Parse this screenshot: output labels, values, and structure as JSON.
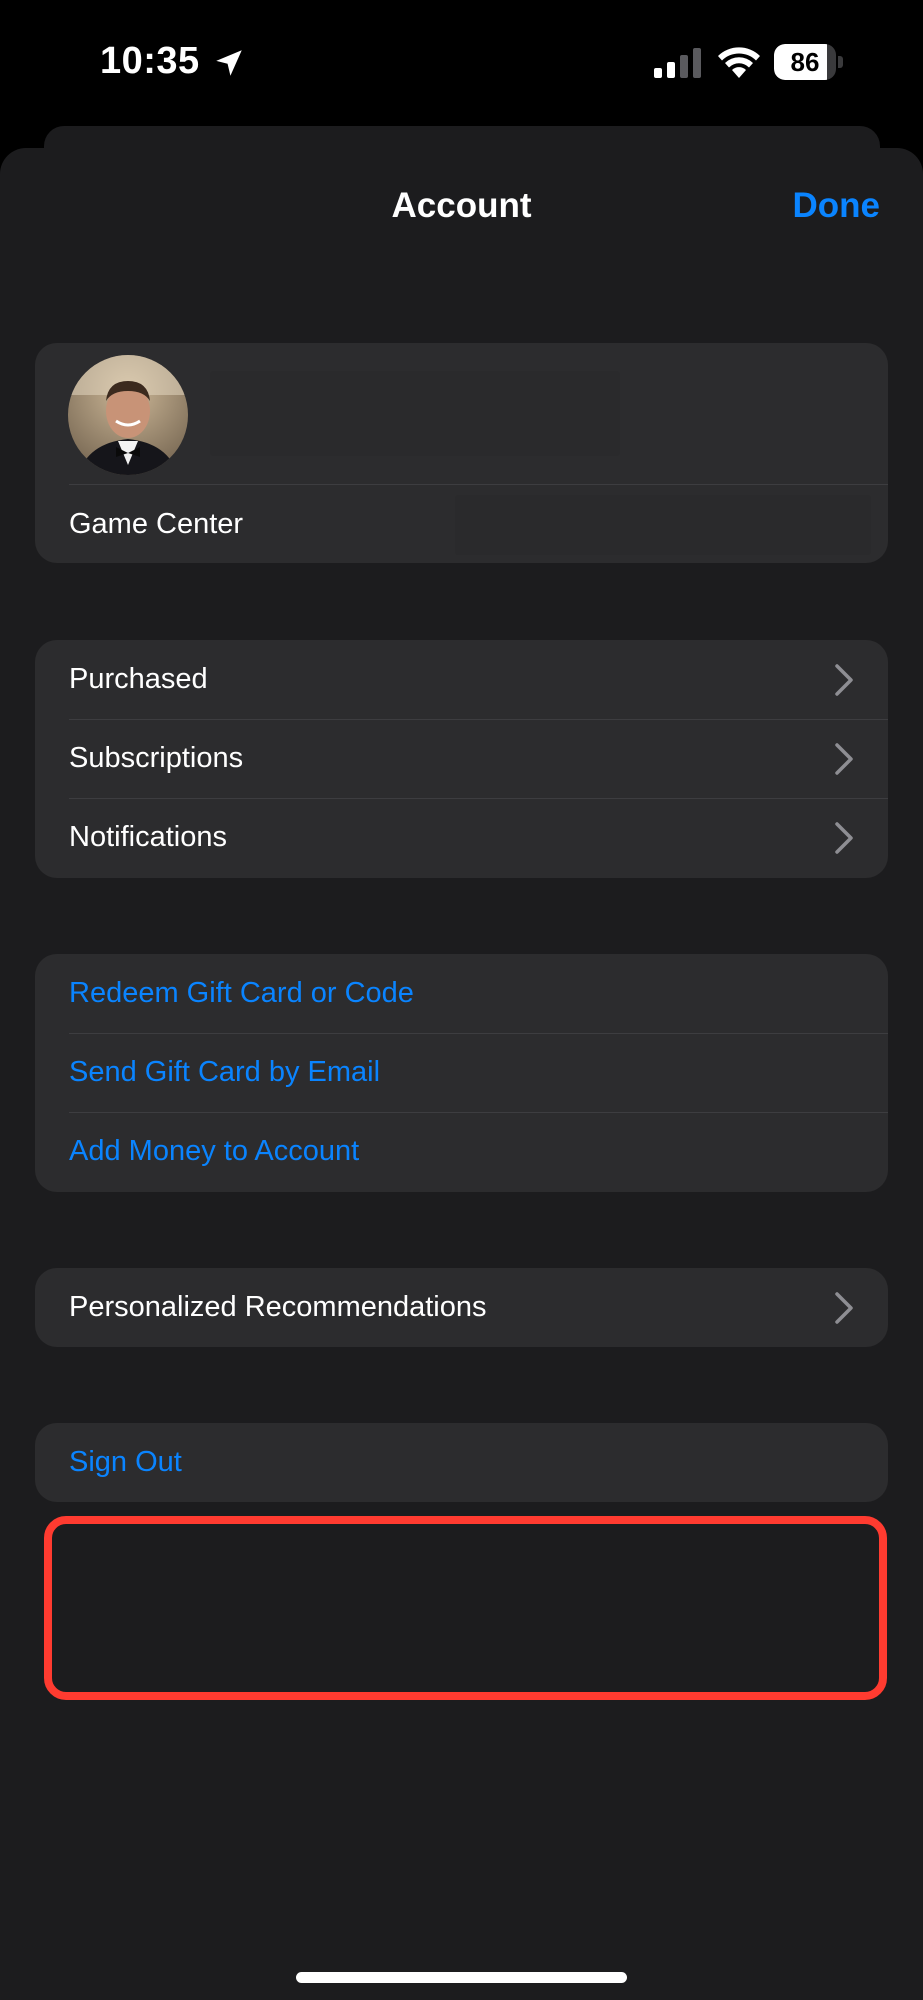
{
  "status_bar": {
    "time": "10:35",
    "battery": "86",
    "battery_level": 0.86
  },
  "nav": {
    "title": "Account",
    "done_label": "Done"
  },
  "profile": {
    "game_center_label": "Game Center"
  },
  "group_nav": {
    "items": [
      {
        "label": "Purchased"
      },
      {
        "label": "Subscriptions"
      },
      {
        "label": "Notifications"
      }
    ]
  },
  "group_gift": {
    "items": [
      {
        "label": "Redeem Gift Card or Code"
      },
      {
        "label": "Send Gift Card by Email"
      },
      {
        "label": "Add Money to Account"
      }
    ]
  },
  "recommendations": {
    "label": "Personalized Recommendations"
  },
  "sign_out": {
    "label": "Sign Out"
  },
  "colors": {
    "accent": "#0a84ff",
    "highlight": "#ff3b30",
    "sheet_bg": "#1c1c1e",
    "cell_bg": "#2c2c2e"
  }
}
